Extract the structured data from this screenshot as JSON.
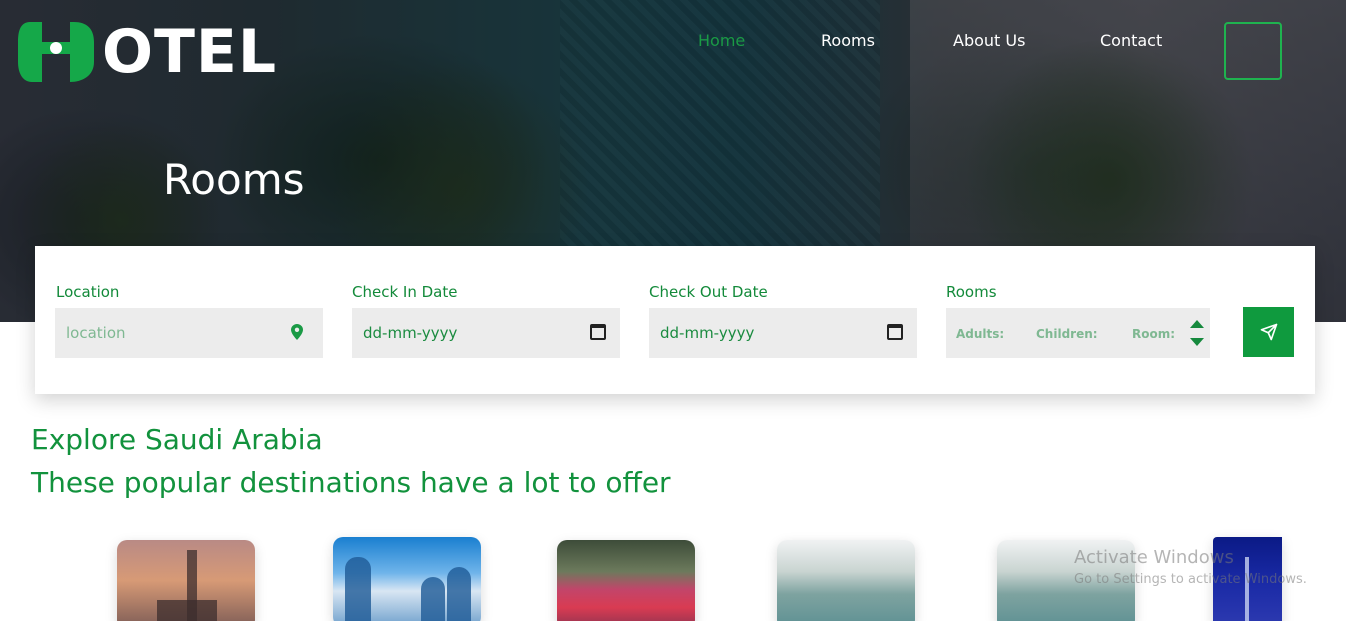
{
  "brand": {
    "logo_text": "OTEL",
    "accent": "#1a9a45"
  },
  "nav": {
    "items": [
      {
        "label": "Home",
        "active": true
      },
      {
        "label": "Rooms",
        "active": false
      },
      {
        "label": "About Us",
        "active": false
      },
      {
        "label": "Contact",
        "active": false
      }
    ]
  },
  "hero": {
    "title": "Rooms"
  },
  "search": {
    "location": {
      "label": "Location",
      "placeholder": "location",
      "icon": "map-pin-icon"
    },
    "check_in": {
      "label": "Check In Date",
      "value": "dd-mm-yyyy",
      "icon": "calendar-icon"
    },
    "check_out": {
      "label": "Check Out Date",
      "value": "dd-mm-yyyy",
      "icon": "calendar-icon"
    },
    "rooms": {
      "label": "Rooms",
      "adults": "Adults:",
      "children": "Children:",
      "room": "Room:"
    },
    "submit_icon": "send-icon"
  },
  "section": {
    "heading_1": "Explore Saudi Arabia",
    "heading_2": "These popular destinations have a lot to offer"
  },
  "watermark": {
    "line1": "Activate Windows",
    "line2": "Go to Settings to activate Windows."
  }
}
